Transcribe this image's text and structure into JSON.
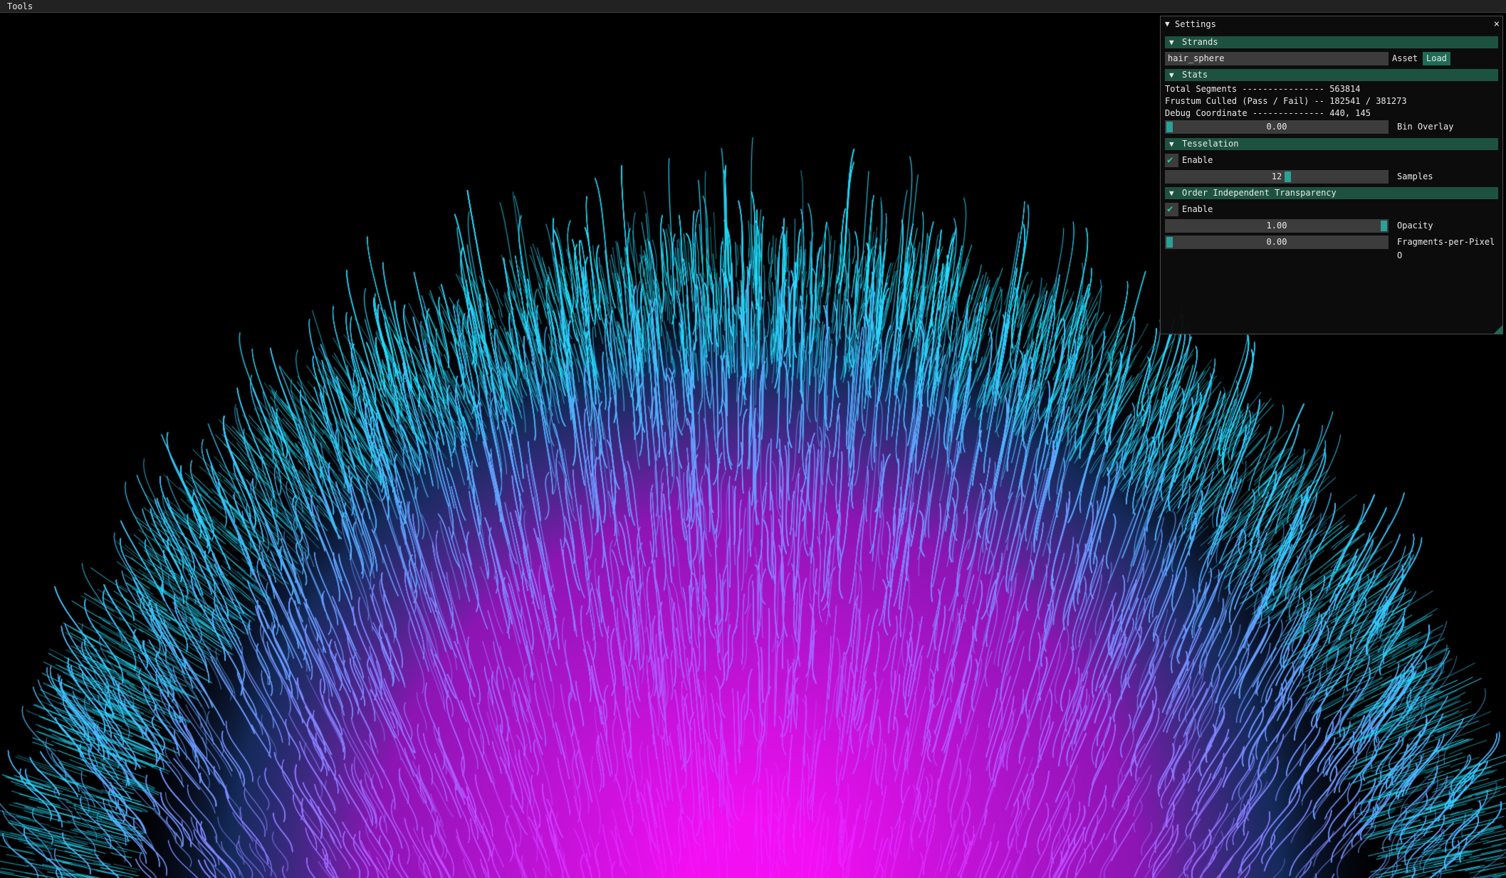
{
  "menu": {
    "tools": "Tools"
  },
  "settings": {
    "title": "Settings",
    "close_label": "×",
    "strands": {
      "header": "Strands",
      "asset_value": "hair_sphere",
      "asset_label": "Asset",
      "load_label": "Load"
    },
    "stats": {
      "header": "Stats",
      "lines": [
        "Total Segments ---------------- 563814",
        "Frustum Culled (Pass / Fail) -- 182541 / 381273",
        "Debug Coordinate -------------- 440, 145"
      ],
      "bin_overlay_value": "0.00",
      "bin_overlay_fraction": 0.0,
      "bin_overlay_label": "Bin Overlay"
    },
    "tesselation": {
      "header": "Tesselation",
      "enable_label": "Enable",
      "enabled": true,
      "samples_value": "12",
      "samples_fraction": 0.55,
      "samples_label": "Samples"
    },
    "oit": {
      "header": "Order Independent Transparency",
      "enable_label": "Enable",
      "enabled": true,
      "opacity_value": "1.00",
      "opacity_fraction": 1.0,
      "opacity_label": "Opacity",
      "fpp_value": "0.00",
      "fpp_fraction": 0.0,
      "fpp_label": "Fragments-per-Pixel O"
    }
  },
  "colors": {
    "header_bg": "#1d5241",
    "accent": "#2aa196",
    "hair_tip": "#22e0ff",
    "hair_root": "#ff10ff"
  },
  "icons": {
    "collapse": "triangle-down-icon",
    "close": "close-icon",
    "check": "check-icon"
  }
}
